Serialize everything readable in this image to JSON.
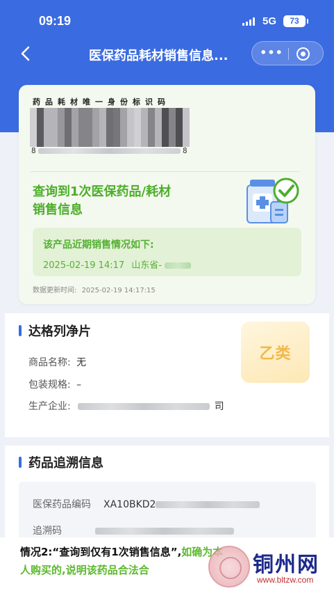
{
  "status_bar": {
    "time": "09:19",
    "network": "5G",
    "battery": "73"
  },
  "nav": {
    "title": "医保药品耗材销售信息...",
    "more_label": "•••"
  },
  "card": {
    "code_label": "药品耗材唯一身份标识码",
    "barcode_first_digit": "8",
    "barcode_last_digit": "8",
    "result_line1": "查询到1次医保药品/耗材",
    "result_line2": "销售信息",
    "sales_title": "该产品近期销售情况如下:",
    "sales_time": "2025-02-19 14:17",
    "sales_place": "山东省-",
    "update_label": "数据更新时间:",
    "update_time": "2025-02-19 14:17:15"
  },
  "product": {
    "name": "达格列净片",
    "category": "乙类",
    "rows": [
      {
        "label": "商品名称:",
        "value": "无"
      },
      {
        "label": "包装规格:",
        "value": "–"
      },
      {
        "label": "生产企业:",
        "value": "司"
      }
    ]
  },
  "trace": {
    "title": "药品追溯信息",
    "code_label": "医保药品编码",
    "code_value": "XA10BKD2",
    "trace_label": "追溯码"
  },
  "caption": {
    "line1_black": "情况2:“查询到仅有1次销售信息”,",
    "line1_green": "如确为本",
    "line2_green": "人购买的,说明该药品合法合"
  },
  "watermark": {
    "name": "铜州网",
    "url": "www.bltzw.com"
  },
  "colors": {
    "primary": "#3a6be0",
    "success": "#4cae2a",
    "category": "#f2b84a"
  }
}
